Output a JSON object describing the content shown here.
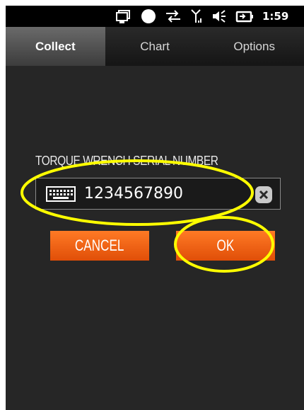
{
  "status_bar": {
    "time": "1:59",
    "icons": [
      "notification-icon",
      "record-dot-icon",
      "sync-arrows-icon",
      "signal-icon",
      "volume-icon",
      "battery-icon"
    ]
  },
  "tabs": [
    {
      "label": "Collect",
      "active": true
    },
    {
      "label": "Chart",
      "active": false
    },
    {
      "label": "Options",
      "active": false
    }
  ],
  "form": {
    "label": "TORQUE WRENCH SERIAL NUMBER",
    "value": "1234567890"
  },
  "buttons": {
    "cancel": "CANCEL",
    "ok": "OK"
  },
  "colors": {
    "button": "#f2641a",
    "annotation": "#ffff00",
    "background": "#262626"
  }
}
